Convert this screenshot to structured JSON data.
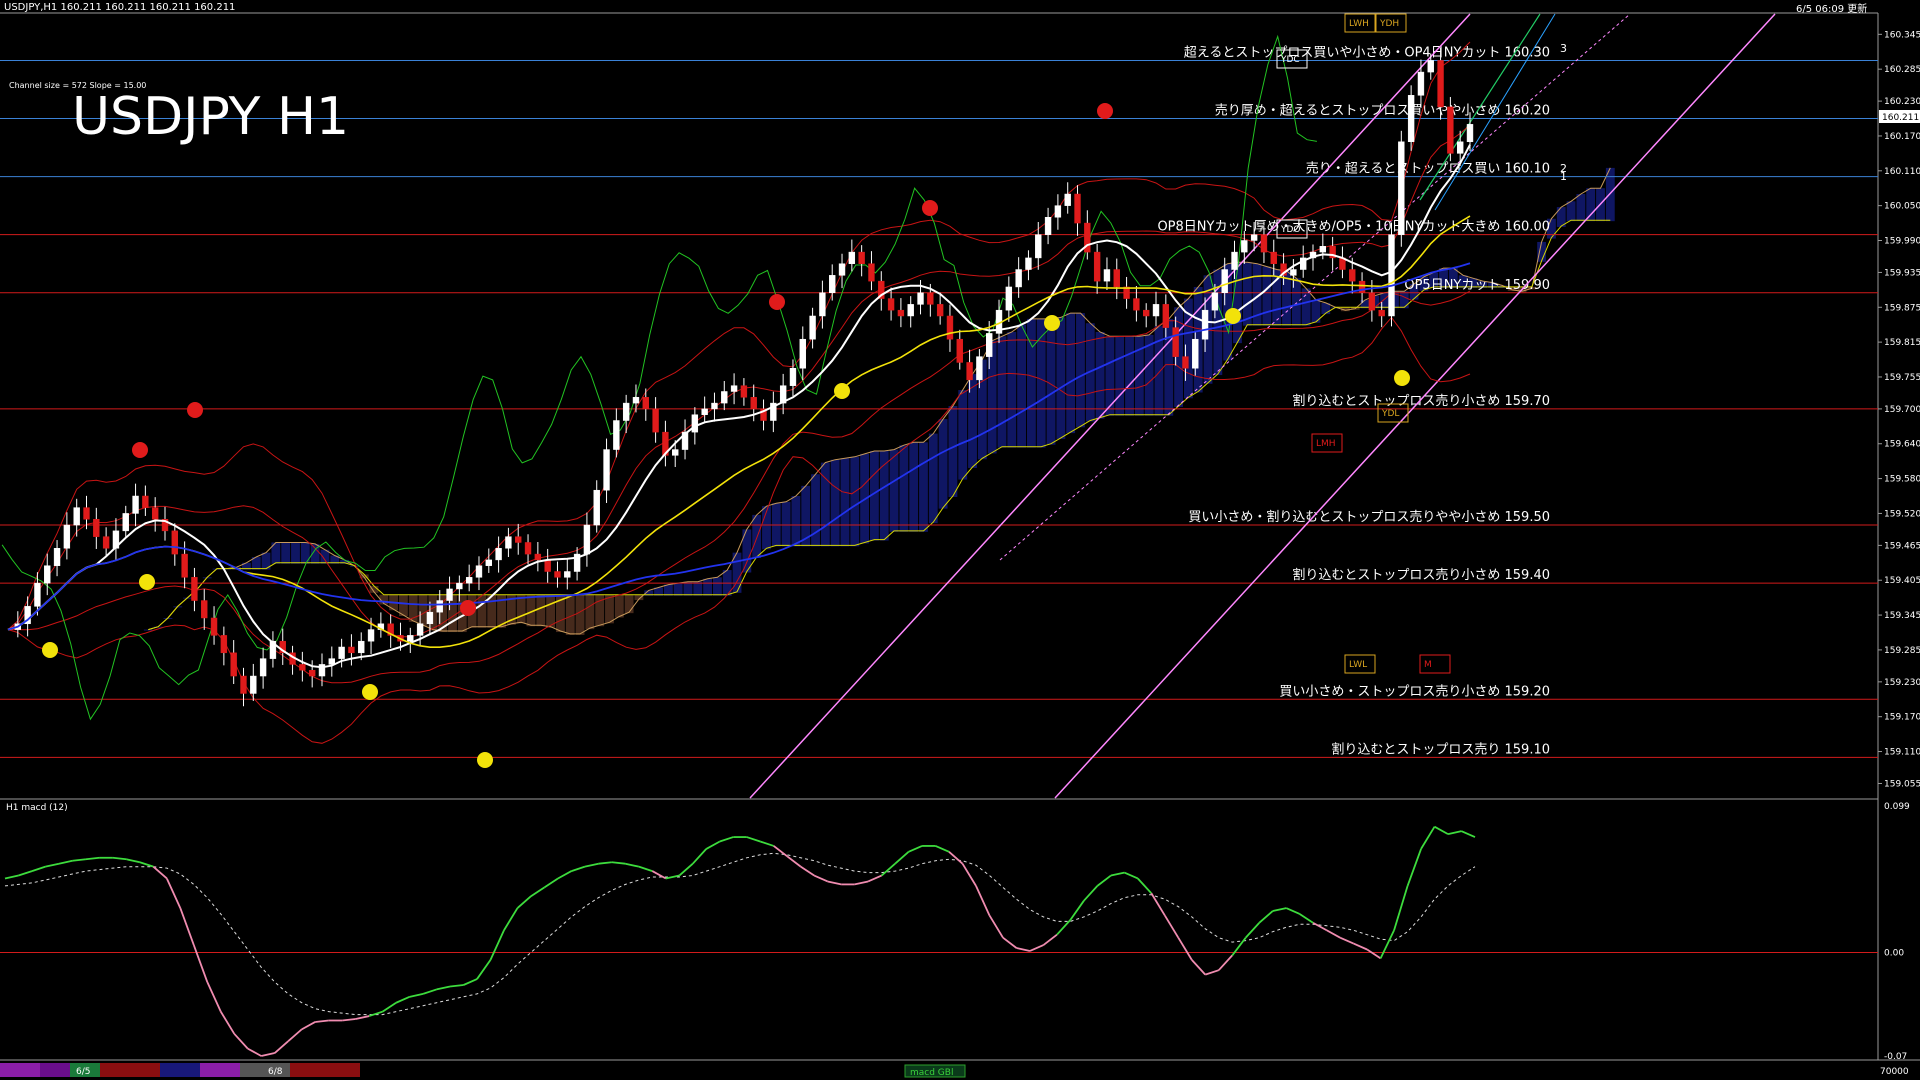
{
  "window": {
    "header": "USDJPY,H1  160.211 160.211 160.211 160.211",
    "datetime": "6/5 06:09 更新"
  },
  "chart_data": {
    "type": "line",
    "title": "USDJPY H1",
    "channel_info": "Channel size = 572 Slope = 15.00",
    "current_price": "160.211",
    "main": {
      "ylim": [
        159.03,
        160.38
      ],
      "y_ticks": [
        "160.345",
        "160.285",
        "160.230",
        "160.170",
        "160.110",
        "160.050",
        "159.990",
        "159.935",
        "159.875",
        "159.815",
        "159.755",
        "159.700",
        "159.640",
        "159.580",
        "159.520",
        "159.465",
        "159.405",
        "159.345",
        "159.285",
        "159.230",
        "159.170",
        "159.110",
        "159.055"
      ],
      "levels": [
        {
          "price": 160.3,
          "label": "超えるとストップロス買いや小さめ・OP4日NYカット 160.30",
          "color": "#3b82d6"
        },
        {
          "price": 160.2,
          "label": "売り厚め・超えるとストップロス買いやや小さめ 160.20",
          "color": "#3b82d6"
        },
        {
          "price": 160.1,
          "label": "売り・超えるとストップロス買い 160.10",
          "color": "#3b82d6"
        },
        {
          "price": 160.0,
          "label": "OP8日NYカット厚め・大きめ/OP5・10日NYカット大きめ 160.00",
          "color": "#d21b1b"
        },
        {
          "price": 159.9,
          "label": "OP5日NYカット 159.90",
          "color": "#d21b1b"
        },
        {
          "price": 159.7,
          "label": "割り込むとストップロス売り小さめ 159.70",
          "color": "#d21b1b"
        },
        {
          "price": 159.5,
          "label": "買い小さめ・割り込むとストップロス売りやや小さめ 159.50",
          "color": "#d21b1b"
        },
        {
          "price": 159.4,
          "label": "割り込むとストップロス売り小さめ 159.40",
          "color": "#d21b1b"
        },
        {
          "price": 159.2,
          "label": "買い小さめ・ストップロス売り小さめ 159.20",
          "color": "#d21b1b"
        },
        {
          "price": 159.1,
          "label": "割り込むとストップロス売り 159.10",
          "color": "#d21b1b"
        }
      ],
      "markers": [
        "LWH",
        "YDH",
        "YDC",
        "YDO",
        "LMH",
        "YDL",
        "LWL",
        "M",
        "3",
        "2",
        "1"
      ],
      "close": [
        159.32,
        159.33,
        159.36,
        159.4,
        159.43,
        159.46,
        159.5,
        159.53,
        159.51,
        159.48,
        159.46,
        159.49,
        159.52,
        159.55,
        159.53,
        159.51,
        159.49,
        159.45,
        159.41,
        159.37,
        159.34,
        159.31,
        159.28,
        159.24,
        159.21,
        159.24,
        159.27,
        159.3,
        159.28,
        159.26,
        159.25,
        159.24,
        159.26,
        159.27,
        159.29,
        159.28,
        159.3,
        159.32,
        159.33,
        159.31,
        159.3,
        159.31,
        159.33,
        159.35,
        159.37,
        159.39,
        159.4,
        159.41,
        159.43,
        159.44,
        159.46,
        159.48,
        159.47,
        159.45,
        159.44,
        159.42,
        159.41,
        159.42,
        159.45,
        159.5,
        159.56,
        159.63,
        159.68,
        159.71,
        159.72,
        159.7,
        159.66,
        159.62,
        159.63,
        159.66,
        159.69,
        159.7,
        159.71,
        159.73,
        159.74,
        159.72,
        159.7,
        159.68,
        159.71,
        159.74,
        159.77,
        159.82,
        159.86,
        159.9,
        159.93,
        159.95,
        159.97,
        159.95,
        159.92,
        159.89,
        159.87,
        159.86,
        159.88,
        159.9,
        159.88,
        159.86,
        159.82,
        159.78,
        159.75,
        159.79,
        159.83,
        159.87,
        159.91,
        159.94,
        159.96,
        160.0,
        160.03,
        160.05,
        160.07,
        160.02,
        159.97,
        159.92,
        159.94,
        159.91,
        159.89,
        159.87,
        159.86,
        159.88,
        159.84,
        159.79,
        159.77,
        159.82,
        159.87,
        159.9,
        159.94,
        159.97,
        159.99,
        160.0,
        159.97,
        159.95,
        159.93,
        159.94,
        159.96,
        159.97,
        159.98,
        159.96,
        159.94,
        159.92,
        159.9,
        159.87,
        159.86,
        160.0,
        160.16,
        160.24,
        160.28,
        160.3,
        160.22,
        160.14,
        160.16,
        160.19
      ]
    },
    "indicator": {
      "title": "H1  macd (12)",
      "ylim": [
        -0.07,
        0.099
      ],
      "y_ticks": [
        "0.099",
        "0.00",
        "-0.07"
      ],
      "macd": [
        0.05,
        0.052,
        0.055,
        0.058,
        0.06,
        0.062,
        0.063,
        0.064,
        0.064,
        0.063,
        0.061,
        0.058,
        0.05,
        0.03,
        0.005,
        -0.02,
        -0.04,
        -0.055,
        -0.065,
        -0.07,
        -0.068,
        -0.06,
        -0.052,
        -0.047,
        -0.046,
        -0.046,
        -0.045,
        -0.043,
        -0.04,
        -0.034,
        -0.03,
        -0.028,
        -0.025,
        -0.023,
        -0.022,
        -0.018,
        -0.005,
        0.015,
        0.03,
        0.038,
        0.044,
        0.05,
        0.055,
        0.058,
        0.06,
        0.061,
        0.06,
        0.058,
        0.055,
        0.05,
        0.052,
        0.06,
        0.07,
        0.075,
        0.078,
        0.078,
        0.075,
        0.072,
        0.065,
        0.058,
        0.052,
        0.048,
        0.046,
        0.046,
        0.048,
        0.052,
        0.06,
        0.068,
        0.072,
        0.072,
        0.068,
        0.06,
        0.045,
        0.025,
        0.01,
        0.003,
        0.001,
        0.005,
        0.012,
        0.022,
        0.035,
        0.045,
        0.052,
        0.054,
        0.05,
        0.04,
        0.025,
        0.01,
        -0.005,
        -0.015,
        -0.012,
        -0.002,
        0.01,
        0.02,
        0.028,
        0.03,
        0.026,
        0.02,
        0.015,
        0.01,
        0.006,
        0.002,
        -0.004,
        0.015,
        0.045,
        0.07,
        0.085,
        0.08,
        0.082,
        0.078
      ],
      "signal": [
        0.045,
        0.046,
        0.047,
        0.049,
        0.051,
        0.053,
        0.055,
        0.056,
        0.057,
        0.058,
        0.058,
        0.058,
        0.057,
        0.053,
        0.046,
        0.037,
        0.026,
        0.014,
        0.002,
        -0.01,
        -0.02,
        -0.028,
        -0.034,
        -0.038,
        -0.04,
        -0.041,
        -0.042,
        -0.042,
        -0.042,
        -0.04,
        -0.038,
        -0.036,
        -0.034,
        -0.032,
        -0.03,
        -0.028,
        -0.024,
        -0.017,
        -0.008,
        0.0,
        0.008,
        0.016,
        0.024,
        0.031,
        0.037,
        0.042,
        0.046,
        0.049,
        0.051,
        0.051,
        0.051,
        0.052,
        0.055,
        0.058,
        0.061,
        0.064,
        0.066,
        0.067,
        0.066,
        0.064,
        0.062,
        0.059,
        0.057,
        0.055,
        0.054,
        0.054,
        0.055,
        0.057,
        0.06,
        0.062,
        0.063,
        0.062,
        0.059,
        0.052,
        0.044,
        0.036,
        0.029,
        0.024,
        0.021,
        0.021,
        0.024,
        0.028,
        0.033,
        0.037,
        0.039,
        0.039,
        0.036,
        0.031,
        0.024,
        0.016,
        0.01,
        0.007,
        0.008,
        0.01,
        0.014,
        0.017,
        0.019,
        0.019,
        0.018,
        0.017,
        0.015,
        0.012,
        0.009,
        0.008,
        0.014,
        0.024,
        0.036,
        0.045,
        0.052,
        0.058
      ]
    },
    "date_labels": [
      "6/5",
      "6/8"
    ],
    "indicator_label": "macd GBl",
    "bottom_right_value": "70000"
  }
}
